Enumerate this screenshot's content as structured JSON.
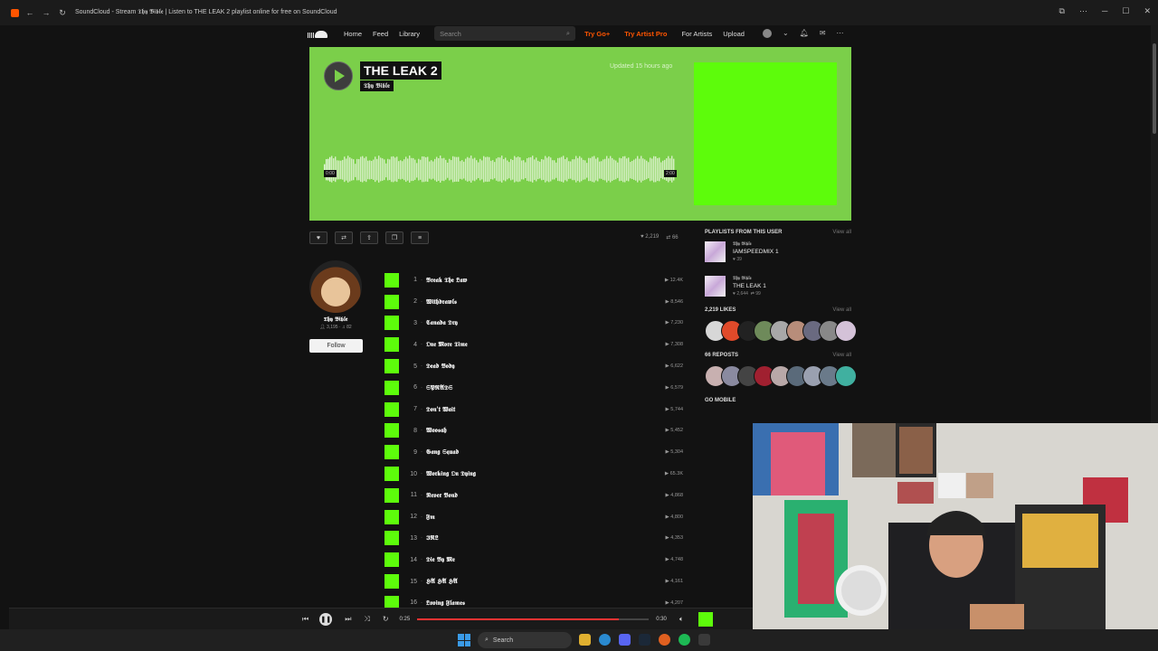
{
  "browser": {
    "title": "SoundCloud - Stream 𝕿𝖍𝖞 𝕭𝖎𝖇𝖑𝖊 | Listen to THE LEAK 2 playlist online for free on SoundCloud"
  },
  "header": {
    "nav": [
      "Home",
      "Feed",
      "Library"
    ],
    "search_placeholder": "Search",
    "try_go": "Try Go+",
    "try_artist": "Try Artist Pro",
    "for_artists": "For Artists",
    "upload": "Upload"
  },
  "hero": {
    "title": "THE LEAK 2",
    "artist": "𝕿𝖍𝖞 𝕭𝖎𝖇𝖑𝖊",
    "updated": "Updated 15 hours ago",
    "time_start": "0:00",
    "time_end": "2:00",
    "color": "#7bcf4a",
    "artwork_color": "#5dfc0b"
  },
  "stats": {
    "likes": "2,219",
    "reposts": "66"
  },
  "artist": {
    "name": "𝕿𝖍𝖞 𝕭𝖎𝖇𝖑𝖊",
    "followers": "3,195",
    "tracks": "82",
    "follow_label": "Follow"
  },
  "tracks": [
    {
      "num": "1",
      "name": "𝕭𝖗𝖊𝖆𝖐 𝕿𝖍𝖊 𝕷𝖆𝖜",
      "plays": "12.4K"
    },
    {
      "num": "2",
      "name": "𝖂𝖎𝖙𝖍𝖉𝖗𝖆𝖜𝖑𝖘",
      "plays": "8,546"
    },
    {
      "num": "3",
      "name": "𝕮𝖆𝖓𝖆𝖉𝖆 𝕯𝖗𝖞",
      "plays": "7,230"
    },
    {
      "num": "4",
      "name": "𝕺𝖓𝖊 𝕸𝖔𝖗𝖊 𝕿𝖎𝖒𝖊",
      "plays": "7,308"
    },
    {
      "num": "5",
      "name": "𝕯𝖊𝖆𝖉 𝕭𝖔𝖉𝖞",
      "plays": "6,622"
    },
    {
      "num": "6",
      "name": "𝕾𝕻𝕽𝕬𝕯𝕾",
      "plays": "6,579"
    },
    {
      "num": "7",
      "name": "𝕯𝖔𝖓'𝖙 𝖂𝖆𝖎𝖙",
      "plays": "5,744"
    },
    {
      "num": "8",
      "name": "𝖂𝖔𝖔𝖘𝖆𝖍",
      "plays": "5,452"
    },
    {
      "num": "9",
      "name": "𝕲𝖆𝖓𝖌 𝕾𝖖𝖚𝖆𝖉",
      "plays": "5,304"
    },
    {
      "num": "10",
      "name": "𝖂𝖔𝖗𝖐𝖎𝖓𝖌 𝕺𝖓 𝕯𝖞𝖎𝖓𝖌",
      "plays": "65.3K"
    },
    {
      "num": "11",
      "name": "𝕹𝖊𝖛𝖊𝖗 𝕭𝖔𝖓𝖉",
      "plays": "4,868"
    },
    {
      "num": "12",
      "name": "𝕱𝖒",
      "plays": "4,800"
    },
    {
      "num": "13",
      "name": "𝕴𝕽𝕷",
      "plays": "4,353"
    },
    {
      "num": "14",
      "name": "𝕯𝖎𝖊 𝕭𝖞 𝕸𝖊",
      "plays": "4,748"
    },
    {
      "num": "15",
      "name": "𝕳𝕬 𝕳𝕬 𝕳𝕬",
      "plays": "4,161"
    },
    {
      "num": "16",
      "name": "𝕷𝖔𝖛𝖎𝖓𝖌 𝕱𝖑𝖆𝖒𝖊𝖘",
      "plays": "4,207"
    }
  ],
  "sidebar": {
    "playlists_heading": "PLAYLISTS FROM THIS USER",
    "view_all": "View all",
    "playlists": [
      {
        "user": "𝕿𝖍𝖞 𝕭𝖎𝖇𝖑𝖊",
        "title": "IAMSPEEDMIX 1",
        "likes": "39",
        "reposts": ""
      },
      {
        "user": "𝕿𝖍𝖞 𝕭𝖎𝖇𝖑𝖊",
        "title": "THE LEAK 1",
        "likes": "2,644",
        "reposts": "99"
      }
    ],
    "likes_heading": "2,219 LIKES",
    "reposts_heading": "66 REPOSTS",
    "go_mobile": "GO MOBILE",
    "like_colors": [
      "#d7d7d7",
      "#e04a2a",
      "#222",
      "#6e8a5a",
      "#a8a8a8",
      "#b88d7a",
      "#6a6a80",
      "#888",
      "#d4c2d8"
    ],
    "repost_colors": [
      "#c8b0b0",
      "#8a8aa0",
      "#444",
      "#a02030",
      "#b8a8a8",
      "#5a6a7a",
      "#9aa0b0",
      "#6a7a8a",
      "#40b0a0"
    ]
  },
  "player": {
    "current": "0:25",
    "total": "0:30",
    "progress": 0.87,
    "now_user": "𝕿𝖍𝖞 𝕭𝖎𝖇𝖑𝖊",
    "now_title": "𝖂𝖔𝖗𝖐𝖎𝖓𝖌 𝕺"
  },
  "taskbar": {
    "search": "Search"
  }
}
